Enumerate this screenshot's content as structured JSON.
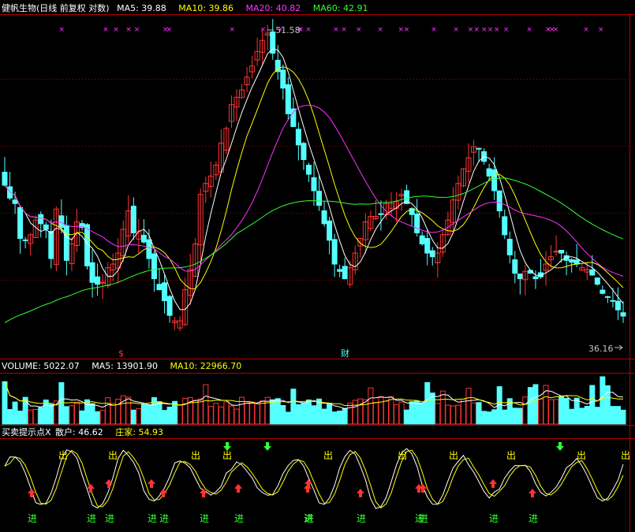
{
  "chart_data": [
    {
      "type": "candlestick",
      "stock_name": "健帆生物",
      "period_label": "(日线 前复权 对数)",
      "ma_values": [
        {
          "label": "MA5",
          "value": "39.88",
          "color": "#ffffff"
        },
        {
          "label": "MA10",
          "value": "39.86",
          "color": "#ffff00"
        },
        {
          "label": "MA20",
          "value": "40.82",
          "color": "#ff33ff"
        },
        {
          "label": "MA60",
          "value": "42.91",
          "color": "#33ff33"
        }
      ],
      "high_label": "51.58",
      "low_label": "36.16",
      "marker_dollar": "$",
      "marker_cai": "财",
      "approx_close": [
        43.3,
        42.6,
        42.3,
        40.4,
        40.3,
        40.6,
        41.4,
        41.2,
        40.9,
        39.3,
        42.0,
        41.0,
        39.2,
        40.1,
        41.3,
        41.0,
        38.9,
        38.0,
        37.9,
        38.0,
        38.8,
        39.0,
        39.6,
        40.9,
        41.9,
        40.7,
        40.8,
        40.2,
        39.3,
        38.2,
        37.6,
        37.0,
        36.2,
        35.9,
        35.9,
        37.6,
        38.7,
        40.1,
        42.8,
        43.4,
        43.8,
        44.4,
        45.6,
        46.4,
        47.7,
        48.1,
        48.5,
        49.2,
        49.8,
        50.6,
        51.2,
        51.6,
        50.5,
        49.5,
        48.6,
        47.2,
        46.5,
        45.5,
        44.7,
        43.9,
        43.0,
        42.2,
        41.2,
        40.3,
        39.0,
        38.6,
        38.2,
        38.8,
        39.6,
        40.4,
        41.3,
        41.6,
        41.6,
        41.7,
        42.3,
        42.3,
        42.4,
        42.8,
        42.3,
        41.7,
        40.7,
        40.1,
        39.6,
        39.4,
        39.6,
        40.6,
        41.4,
        42.5,
        43.4,
        44.2,
        44.8,
        45.4,
        45.3,
        44.6,
        43.8,
        43.0,
        41.9,
        40.6,
        39.5,
        38.5,
        38.2,
        38.6,
        38.5,
        38.2,
        38.3,
        39.0,
        39.4,
        39.7,
        39.6,
        39.2,
        39.1,
        39.0,
        38.8,
        38.7,
        38.4,
        37.9,
        37.4,
        37.2,
        37.0,
        36.5,
        36.16
      ]
    },
    {
      "type": "bar",
      "label": "VOLUME",
      "value": "5022.07",
      "ma5_label": "MA5",
      "ma5_value": "13901.90",
      "ma10_label": "MA10",
      "ma10_value": "22966.70"
    },
    {
      "type": "line",
      "title": "买卖提示点X",
      "retail_label": "散户",
      "retail_value": "46.62",
      "dealer_label": "庄家",
      "dealer_value": "54.93",
      "buy_label": "进",
      "sell_label": "出",
      "buy_signal_count": 14,
      "sell_signal_count": 10
    }
  ],
  "colors": {
    "up": "#ff3333",
    "down": "#54ffff",
    "ma5": "#ffffff",
    "ma10": "#ffff00",
    "ma20": "#ff33ff",
    "ma60": "#33ff33",
    "grid": "#b00000",
    "buy_text": "#33ff33",
    "sell_text": "#ffff00",
    "buy_arrow": "#ff3333",
    "sell_arrow": "#33ff33",
    "label_gray": "#c0c0c0"
  }
}
